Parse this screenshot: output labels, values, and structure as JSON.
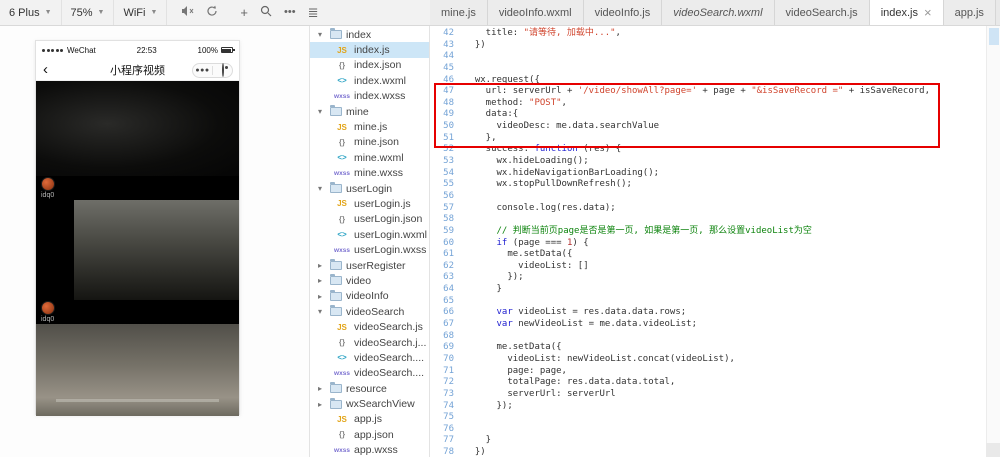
{
  "toolbar": {
    "device": "6 Plus",
    "zoom": "75%",
    "network": "WiFi",
    "icons": [
      "mute",
      "rotate",
      "add",
      "search",
      "more",
      "list"
    ]
  },
  "simulator": {
    "status": {
      "carrier": "WeChat",
      "time": "22:53",
      "battery": "100%"
    },
    "nav": {
      "back": "‹",
      "title": "小程序视频"
    },
    "videos": [
      {
        "user": "idq0"
      },
      {
        "user": "idq0"
      }
    ]
  },
  "explorer": {
    "items": [
      {
        "type": "folder",
        "label": "index",
        "expanded": true
      },
      {
        "type": "file",
        "kind": "js",
        "label": "index.js",
        "selected": true
      },
      {
        "type": "file",
        "kind": "json",
        "label": "index.json"
      },
      {
        "type": "file",
        "kind": "wxml",
        "label": "index.wxml"
      },
      {
        "type": "file",
        "kind": "wxss",
        "label": "index.wxss"
      },
      {
        "type": "folder",
        "label": "mine",
        "expanded": true
      },
      {
        "type": "file",
        "kind": "js",
        "label": "mine.js"
      },
      {
        "type": "file",
        "kind": "json",
        "label": "mine.json"
      },
      {
        "type": "file",
        "kind": "wxml",
        "label": "mine.wxml"
      },
      {
        "type": "file",
        "kind": "wxss",
        "label": "mine.wxss"
      },
      {
        "type": "folder",
        "label": "userLogin",
        "expanded": true
      },
      {
        "type": "file",
        "kind": "js",
        "label": "userLogin.js"
      },
      {
        "type": "file",
        "kind": "json",
        "label": "userLogin.json"
      },
      {
        "type": "file",
        "kind": "wxml",
        "label": "userLogin.wxml"
      },
      {
        "type": "file",
        "kind": "wxss",
        "label": "userLogin.wxss"
      },
      {
        "type": "folder",
        "label": "userRegister",
        "expanded": false
      },
      {
        "type": "folder",
        "label": "video",
        "expanded": false
      },
      {
        "type": "folder",
        "label": "videoInfo",
        "expanded": false
      },
      {
        "type": "folder",
        "label": "videoSearch",
        "expanded": true
      },
      {
        "type": "file",
        "kind": "js",
        "label": "videoSearch.js"
      },
      {
        "type": "file",
        "kind": "json",
        "label": "videoSearch.j..."
      },
      {
        "type": "file",
        "kind": "wxml",
        "label": "videoSearch...."
      },
      {
        "type": "file",
        "kind": "wxss",
        "label": "videoSearch...."
      },
      {
        "type": "folder",
        "label": "resource",
        "expanded": false
      },
      {
        "type": "folder",
        "label": "wxSearchView",
        "expanded": false
      },
      {
        "type": "file",
        "kind": "js",
        "label": "app.js"
      },
      {
        "type": "file",
        "kind": "json",
        "label": "app.json"
      },
      {
        "type": "file",
        "kind": "wxss",
        "label": "app.wxss"
      }
    ]
  },
  "editor": {
    "tabs": [
      {
        "label": "mine.js"
      },
      {
        "label": "videoInfo.wxml"
      },
      {
        "label": "videoInfo.js"
      },
      {
        "label": "videoSearch.wxml",
        "italic": true
      },
      {
        "label": "videoSearch.js"
      },
      {
        "label": "index.js",
        "active": true,
        "closable": true
      },
      {
        "label": "app.js"
      }
    ],
    "first_line": 42,
    "annotation": {
      "from_line": 47,
      "to_line": 51,
      "color": "#e60000"
    },
    "code_lines": [
      {
        "n": 42,
        "segs": [
          {
            "t": "    title: "
          },
          {
            "t": "\"请等待, 加载中...\"",
            "c": "str"
          },
          {
            "t": ","
          }
        ]
      },
      {
        "n": 43,
        "segs": [
          {
            "t": "  })"
          }
        ]
      },
      {
        "n": 44,
        "segs": []
      },
      {
        "n": 45,
        "segs": []
      },
      {
        "n": 46,
        "segs": [
          {
            "t": "  wx.request({"
          }
        ]
      },
      {
        "n": 47,
        "segs": [
          {
            "t": "    url: serverUrl + "
          },
          {
            "t": "'/video/showAll?page='",
            "c": "str"
          },
          {
            "t": " + page + "
          },
          {
            "t": "\"&isSaveRecord =\"",
            "c": "str"
          },
          {
            "t": " + isSaveRecord,"
          }
        ]
      },
      {
        "n": 48,
        "segs": [
          {
            "t": "    method: "
          },
          {
            "t": "\"POST\"",
            "c": "str"
          },
          {
            "t": ","
          }
        ]
      },
      {
        "n": 49,
        "segs": [
          {
            "t": "    data:{"
          }
        ]
      },
      {
        "n": 50,
        "segs": [
          {
            "t": "      videoDesc: me.data.searchValue"
          }
        ]
      },
      {
        "n": 51,
        "segs": [
          {
            "t": "    },"
          }
        ]
      },
      {
        "n": 52,
        "segs": [
          {
            "t": "    success: "
          },
          {
            "t": "function",
            "c": "kw"
          },
          {
            "t": " (res) {"
          }
        ]
      },
      {
        "n": 53,
        "segs": [
          {
            "t": "      wx.hideLoading();"
          }
        ]
      },
      {
        "n": 54,
        "segs": [
          {
            "t": "      wx.hideNavigationBarLoading();"
          }
        ]
      },
      {
        "n": 55,
        "segs": [
          {
            "t": "      wx.stopPullDownRefresh();"
          }
        ]
      },
      {
        "n": 56,
        "segs": []
      },
      {
        "n": 57,
        "segs": [
          {
            "t": "      console.log(res.data);"
          }
        ]
      },
      {
        "n": 58,
        "segs": []
      },
      {
        "n": 59,
        "segs": [
          {
            "t": "      "
          },
          {
            "t": "// 判断当前页page是否是第一页, 如果是第一页, 那么设置videoList为空",
            "c": "cmt"
          }
        ]
      },
      {
        "n": 60,
        "segs": [
          {
            "t": "      "
          },
          {
            "t": "if",
            "c": "kw"
          },
          {
            "t": " (page === "
          },
          {
            "t": "1",
            "c": "num"
          },
          {
            "t": ") {"
          }
        ]
      },
      {
        "n": 61,
        "segs": [
          {
            "t": "        me.setData({"
          }
        ]
      },
      {
        "n": 62,
        "segs": [
          {
            "t": "          videoList: []"
          }
        ]
      },
      {
        "n": 63,
        "segs": [
          {
            "t": "        });"
          }
        ]
      },
      {
        "n": 64,
        "segs": [
          {
            "t": "      }"
          }
        ]
      },
      {
        "n": 65,
        "segs": []
      },
      {
        "n": 66,
        "segs": [
          {
            "t": "      "
          },
          {
            "t": "var",
            "c": "kw"
          },
          {
            "t": " videoList = res.data.data.rows;"
          }
        ]
      },
      {
        "n": 67,
        "segs": [
          {
            "t": "      "
          },
          {
            "t": "var",
            "c": "kw"
          },
          {
            "t": " newVideoList = me.data.videoList;"
          }
        ]
      },
      {
        "n": 68,
        "segs": []
      },
      {
        "n": 69,
        "segs": [
          {
            "t": "      me.setData({"
          }
        ]
      },
      {
        "n": 70,
        "segs": [
          {
            "t": "        videoList: newVideoList.concat(videoList),"
          }
        ]
      },
      {
        "n": 71,
        "segs": [
          {
            "t": "        page: page,"
          }
        ]
      },
      {
        "n": 72,
        "segs": [
          {
            "t": "        totalPage: res.data.data.total,"
          }
        ]
      },
      {
        "n": 73,
        "segs": [
          {
            "t": "        serverUrl: serverUrl"
          }
        ]
      },
      {
        "n": 74,
        "segs": [
          {
            "t": "      });"
          }
        ]
      },
      {
        "n": 75,
        "segs": []
      },
      {
        "n": 76,
        "segs": []
      },
      {
        "n": 77,
        "segs": [
          {
            "t": "    }"
          }
        ]
      },
      {
        "n": 78,
        "segs": [
          {
            "t": "  })"
          }
        ]
      }
    ]
  }
}
